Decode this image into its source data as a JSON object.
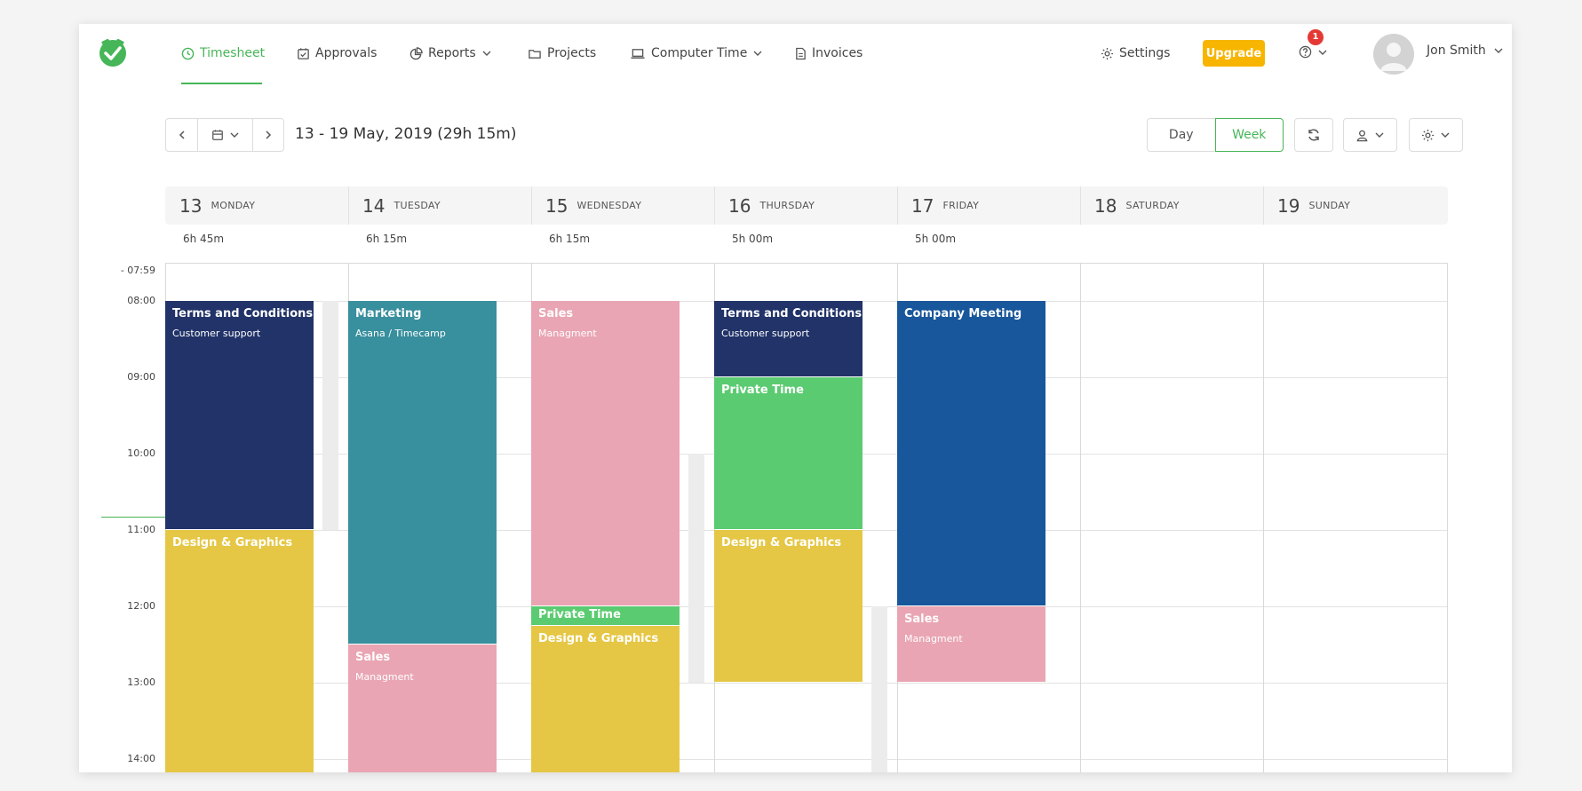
{
  "nav": {
    "items": [
      {
        "label": "Timesheet",
        "icon": "clock-icon",
        "active": true
      },
      {
        "label": "Approvals",
        "icon": "calendar-check-icon"
      },
      {
        "label": "Reports",
        "icon": "pie-chart-icon",
        "dropdown": true
      },
      {
        "label": "Projects",
        "icon": "folder-icon"
      },
      {
        "label": "Computer Time",
        "icon": "laptop-icon",
        "dropdown": true
      },
      {
        "label": "Invoices",
        "icon": "document-icon"
      }
    ],
    "settings_label": "Settings",
    "upgrade_label": "Upgrade",
    "notification_count": "1",
    "user_name": "Jon Smith"
  },
  "toolbar": {
    "date_range": "13 - 19 May, 2019 (29h 15m)",
    "day_label": "Day",
    "week_label": "Week"
  },
  "days": [
    {
      "num": "13",
      "name": "MONDAY",
      "total": "6h 45m"
    },
    {
      "num": "14",
      "name": "TUESDAY",
      "total": "6h 15m"
    },
    {
      "num": "15",
      "name": "WEDNESDAY",
      "total": "6h 15m"
    },
    {
      "num": "16",
      "name": "THURSDAY",
      "total": "5h 00m"
    },
    {
      "num": "17",
      "name": "FRIDAY",
      "total": "5h 00m"
    },
    {
      "num": "18",
      "name": "SATURDAY",
      "total": ""
    },
    {
      "num": "19",
      "name": "SUNDAY",
      "total": ""
    }
  ],
  "time_labels": [
    "- 07:59",
    "08:00",
    "09:00",
    "10:00",
    "11:00",
    "12:00",
    "13:00",
    "14:00"
  ],
  "colors": {
    "accent": "#46b658",
    "navy": "#213368",
    "teal": "#388f9d",
    "pink": "#e9a5b3",
    "green": "#5bcb71",
    "yellow": "#e5c745",
    "blue": "#18579b",
    "upgrade": "#f7b500"
  },
  "entries": [
    {
      "day": 0,
      "start": "08:00",
      "end": "11:00",
      "title": "Terms and Conditions",
      "sub": "Customer support",
      "color": "#213368"
    },
    {
      "day": 0,
      "start": "11:00",
      "end": "14:45",
      "title": "Design & Graphics",
      "sub": "",
      "color": "#e5c745"
    },
    {
      "day": 1,
      "start": "08:00",
      "end": "12:30",
      "title": "Marketing",
      "sub": "Asana / Timecamp",
      "color": "#388f9d"
    },
    {
      "day": 1,
      "start": "12:30",
      "end": "14:45",
      "title": "Sales",
      "sub": "Managment",
      "color": "#e9a5b3"
    },
    {
      "day": 2,
      "start": "08:00",
      "end": "12:00",
      "title": "Sales",
      "sub": "Managment",
      "color": "#e9a5b3"
    },
    {
      "day": 2,
      "start": "12:00",
      "end": "12:15",
      "title": "Private Time",
      "sub": "",
      "color": "#5bcb71"
    },
    {
      "day": 2,
      "start": "12:15",
      "end": "14:45",
      "title": "Design & Graphics",
      "sub": "",
      "color": "#e5c745"
    },
    {
      "day": 3,
      "start": "08:00",
      "end": "09:00",
      "title": "Terms and Conditions",
      "sub": "Customer support",
      "color": "#213368"
    },
    {
      "day": 3,
      "start": "09:00",
      "end": "11:00",
      "title": "Private Time",
      "sub": "",
      "color": "#5bcb71"
    },
    {
      "day": 3,
      "start": "11:00",
      "end": "13:00",
      "title": "Design & Graphics",
      "sub": "",
      "color": "#e5c745"
    },
    {
      "day": 4,
      "start": "08:00",
      "end": "12:00",
      "title": "Company Meeting",
      "sub": "",
      "color": "#18579b"
    },
    {
      "day": 4,
      "start": "12:00",
      "end": "13:00",
      "title": "Sales",
      "sub": "Managment",
      "color": "#e9a5b3"
    }
  ],
  "gaps": [
    {
      "day": 0,
      "start": "08:00",
      "end": "11:00"
    },
    {
      "day": 2,
      "start": "10:00",
      "end": "13:00"
    },
    {
      "day": 3,
      "start": "12:00",
      "end": "14:45"
    }
  ]
}
